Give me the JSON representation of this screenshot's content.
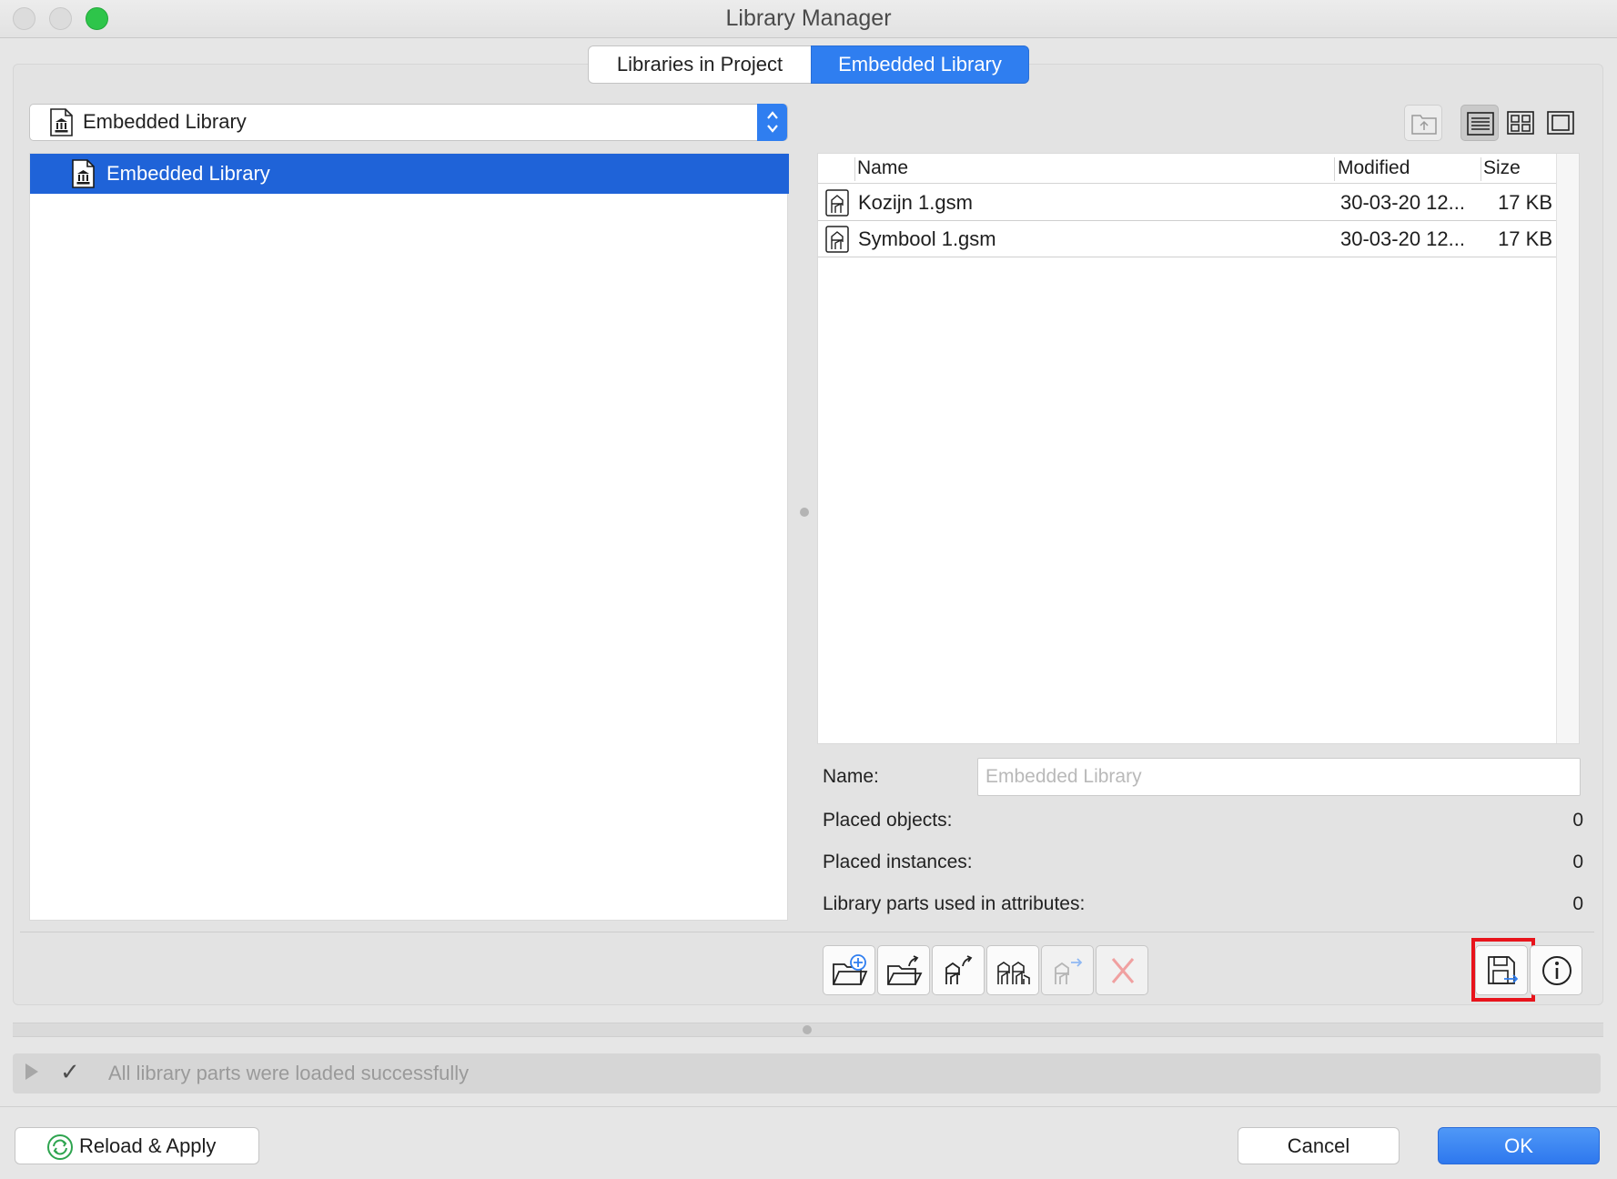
{
  "window": {
    "title": "Library Manager"
  },
  "tabs": [
    {
      "label": "Libraries in Project",
      "active": false
    },
    {
      "label": "Embedded Library",
      "active": true
    }
  ],
  "library_selector": {
    "value": "Embedded Library"
  },
  "tree": {
    "selected_item": "Embedded Library"
  },
  "file_list": {
    "columns": [
      "Name",
      "Modified",
      "Size"
    ],
    "rows": [
      {
        "name": "Kozijn 1.gsm",
        "modified": "30-03-20 12...",
        "size": "17 KB"
      },
      {
        "name": "Symbool 1.gsm",
        "modified": "30-03-20 12...",
        "size": "17 KB"
      }
    ]
  },
  "properties": {
    "name_label": "Name:",
    "name_placeholder": "Embedded Library",
    "placed_objects_label": "Placed objects:",
    "placed_objects_value": "0",
    "placed_instances_label": "Placed instances:",
    "placed_instances_value": "0",
    "library_parts_label": "Library parts used in attributes:",
    "library_parts_value": "0"
  },
  "toolbar": {
    "icons": [
      "new-folder-icon",
      "import-folder-icon",
      "import-object-icon",
      "objects-icon",
      "move-object-icon",
      "delete-icon",
      "save-export-icon",
      "info-icon"
    ]
  },
  "status": {
    "message": "All library parts were loaded successfully"
  },
  "buttons": {
    "reload": "Reload & Apply",
    "cancel": "Cancel",
    "ok": "OK"
  },
  "colors": {
    "accent": "#2f7ef0",
    "selection": "#1f63d8",
    "highlight": "#e8141c",
    "reload_green": "#2ea44f"
  }
}
